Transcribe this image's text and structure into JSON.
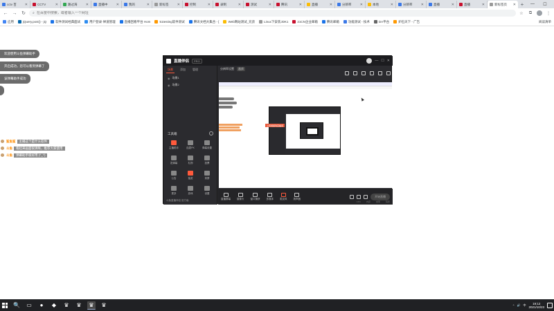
{
  "browser": {
    "tabs": [
      {
        "label": "cctv 百",
        "color": "#3b78e7"
      },
      {
        "label": "CCTV",
        "color": "#c8102e"
      },
      {
        "label": "路过海",
        "color": "#34a853"
      },
      {
        "label": "直播中",
        "color": "#3b78e7"
      },
      {
        "label": "我的",
        "color": "#3b78e7"
      },
      {
        "label": "新标签",
        "color": "#999999"
      },
      {
        "label": "控制",
        "color": "#c8102e"
      },
      {
        "label": "录制",
        "color": "#c8102e"
      },
      {
        "label": "测试",
        "color": "#c8102e"
      },
      {
        "label": "腾讯",
        "color": "#c8102e"
      },
      {
        "label": "直播",
        "color": "#fbbc04"
      },
      {
        "label": "分辨率",
        "color": "#3b78e7"
      },
      {
        "label": "本地",
        "color": "#fbbc04"
      },
      {
        "label": "分辨率",
        "color": "#3b78e7"
      },
      {
        "label": "直播",
        "color": "#3b78e7"
      },
      {
        "label": "直播",
        "color": "#c8102e"
      },
      {
        "label": "新标签页",
        "color": "#999999",
        "active": true
      }
    ],
    "new_tab": "+",
    "window_controls": {
      "minimize": "—",
      "maximize": "☐",
      "close": "✕"
    },
    "toolbar": {
      "back": "←",
      "forward": "→",
      "reload": "↻",
      "omnibox_placeholder": "在百度中搜索，或者输入一个网址"
    },
    "bookmarks": [
      {
        "label": "应用",
        "color": "#4285f4"
      },
      {
        "label": "jQuery.post() - jQ",
        "color": "#0769ad"
      },
      {
        "label": "软件测试经典面试",
        "color": "#1a73e8"
      },
      {
        "label": "用户登录·禅道管理",
        "color": "#2d8cf0"
      },
      {
        "label": "直播回看平台 Hom",
        "color": "#1a73e8"
      },
      {
        "label": "51testing软件测试",
        "color": "#ff9900"
      },
      {
        "label": "腾讯文档大集合 - [",
        "color": "#1a73e8"
      },
      {
        "label": "Web网站测试_兄弟",
        "color": "#fbbc04"
      },
      {
        "label": "Linux下安装JDK1",
        "color": "#999999"
      },
      {
        "label": "21CN企业邮箱",
        "color": "#c8102e"
      },
      {
        "label": "腾讯邮箱",
        "color": "#1a73e8"
      },
      {
        "label": "功能测试 - 技术",
        "color": "#3b78e7"
      },
      {
        "label": "DA平台",
        "color": "#666666"
      },
      {
        "label": "炉石天下 - 广告",
        "color": "#ff9900"
      }
    ],
    "reading_list": "阅读清单"
  },
  "page": {
    "toasts": [
      "欢迎使用斗鱼弹幕助手",
      "开启成功，您可以看到弹幕了",
      "该弹幕助手成功",
      ""
    ],
    "comments": [
      {
        "name": "鲨鱼鲨",
        "text": "主播这个是什么软件"
      },
      {
        "name": "斗鱼",
        "text": "看起来画面很清晰，推荐大家使用"
      },
      {
        "name": "斗鱼",
        "text": "弹幕助手很好用 (^_^)"
      }
    ]
  },
  "app": {
    "title": "直播伴侣",
    "version": "PRO",
    "left_tabs": [
      "场景",
      "添加",
      "管理"
    ],
    "scenes": [
      "场景1",
      "场景2"
    ],
    "tools_label": "工具箱",
    "tools": [
      {
        "label": "主播助手",
        "hot": true
      },
      {
        "label": "连麦PK",
        "hot": false
      },
      {
        "label": "弹幕设置",
        "hot": false
      },
      {
        "label": "发弹幕",
        "hot": false
      },
      {
        "label": "礼物",
        "hot": false
      },
      {
        "label": "投票",
        "hot": false
      },
      {
        "label": "公告",
        "hot": false
      },
      {
        "label": "抽奖",
        "hot": true
      },
      {
        "label": "录屏",
        "hot": false
      },
      {
        "label": "更多",
        "hot": false
      },
      {
        "label": "游戏",
        "hot": false
      },
      {
        "label": "设置",
        "hot": false
      }
    ],
    "left_bottom": "斗鱼直播伴侣 官方版",
    "scene_tabs": [
      "分辨率设置",
      "画质"
    ],
    "preview_banner": "上传视频到直播间",
    "controls": [
      "直播屏幕",
      "摄像头",
      "窗口捕获",
      "多媒体",
      "麦克风",
      "扬声器"
    ],
    "go_live": "开始直播",
    "status": [
      "CPU",
      "内存",
      "帧率",
      "码率"
    ]
  },
  "taskbar": {
    "items": [
      "🔍",
      "▭",
      "●",
      "◆",
      "♛",
      "♛",
      "♛",
      "♛"
    ],
    "tray": [
      "^",
      "🔊",
      "中"
    ],
    "time": "19:12",
    "date": "2021/10/23"
  }
}
